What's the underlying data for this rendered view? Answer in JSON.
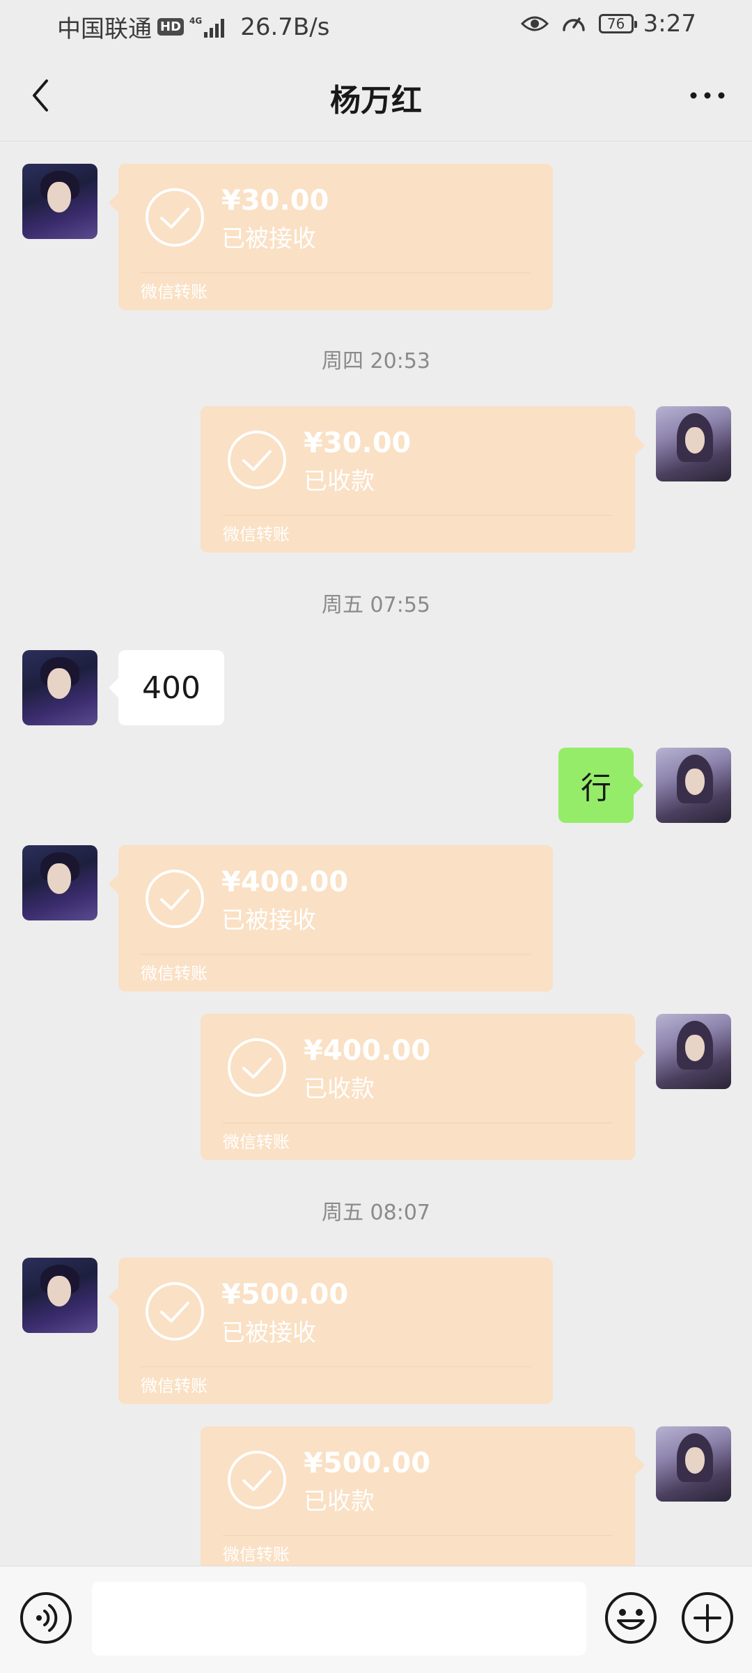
{
  "status_bar": {
    "carrier": "中国联通",
    "hd": "HD",
    "network": "4G",
    "speed": "26.7B/s",
    "battery": "76",
    "time": "3:27"
  },
  "nav": {
    "title": "杨万红",
    "back_icon": "chevron-left-icon",
    "more_icon": "more-dots-icon"
  },
  "messages": {
    "m1": {
      "amount": "¥30.00",
      "status": "已被接收",
      "label": "微信转账"
    },
    "t1": "周四 20:53",
    "m2": {
      "amount": "¥30.00",
      "status": "已收款",
      "label": "微信转账"
    },
    "t2": "周五 07:55",
    "m3": {
      "text": "400"
    },
    "m4": {
      "text": "行"
    },
    "m5": {
      "amount": "¥400.00",
      "status": "已被接收",
      "label": "微信转账"
    },
    "m6": {
      "amount": "¥400.00",
      "status": "已收款",
      "label": "微信转账"
    },
    "t3": "周五 08:07",
    "m7": {
      "amount": "¥500.00",
      "status": "已被接收",
      "label": "微信转账"
    },
    "m8": {
      "amount": "¥500.00",
      "status": "已收款",
      "label": "微信转账"
    }
  },
  "input_bar": {
    "placeholder": "",
    "voice_icon": "voice-icon",
    "emoji_icon": "emoji-icon",
    "plus_icon": "plus-icon"
  },
  "colors": {
    "background": "#ededed",
    "transfer_card": "#fae0c4",
    "sent_bubble": "#95ec69",
    "received_bubble": "#ffffff"
  }
}
